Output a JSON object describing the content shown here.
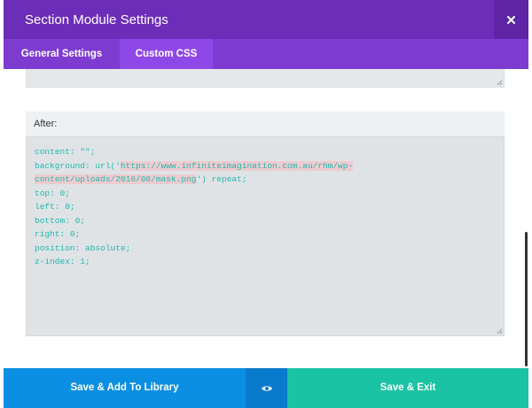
{
  "header": {
    "title": "Section Module Settings",
    "close_icon": "close-icon"
  },
  "tabs": [
    {
      "label": "General Settings",
      "active": false
    },
    {
      "label": "Custom CSS",
      "active": true
    }
  ],
  "after_section": {
    "label": "After:",
    "code_lines": {
      "line1": "content: \"\";",
      "line2_prefix": "background: url('",
      "line2_url": "https://www.infiniteimagination.com.au/rhm/wp-",
      "line3_url": "content/uploads/2016/08/mask.png",
      "line3_suffix": "') repeat;",
      "line4": "top: 0;",
      "line5": "left: 0;",
      "line6": "bottom: 0;",
      "line7": "right: 0;",
      "line8": "position: absolute;",
      "line9": "z-index: 1;"
    }
  },
  "footer": {
    "save_library_label": "Save & Add To Library",
    "preview_icon": "eye-icon",
    "save_exit_label": "Save & Exit"
  },
  "colors": {
    "header_bg": "#6c2eb9",
    "tab_bar_bg": "#7e3bd0",
    "active_tab_bg": "#8f48e8",
    "code_text": "#22b8aa",
    "library_button_bg": "#0b8fe3",
    "exit_button_bg": "#19c3a3"
  }
}
